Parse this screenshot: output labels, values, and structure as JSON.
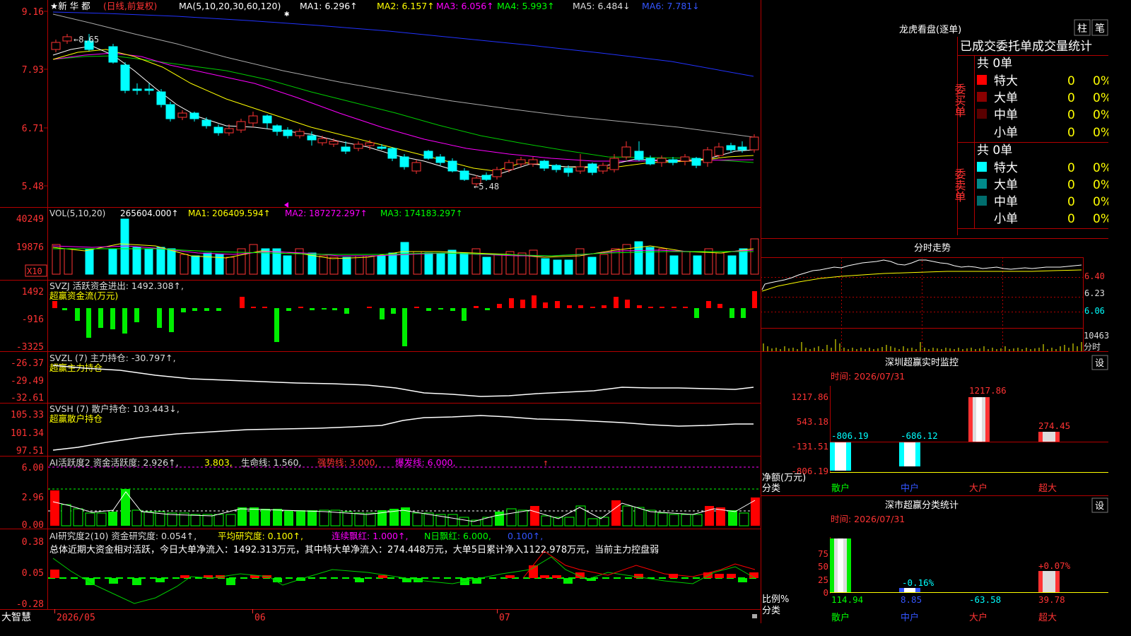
{
  "app": {
    "name": "大智慧"
  },
  "stock": {
    "name": "★新 华 都",
    "mode": "(日线,前复权)"
  },
  "ma_header": {
    "label": "MA(5,10,20,30,60,120)",
    "ma1": "MA1: 6.296↑",
    "ma2": "MA2: 6.157↑",
    "ma3": "MA3: 6.056↑",
    "ma4": "MA4: 5.993↑",
    "ma5": "MA5: 6.484↓",
    "ma6": "MA6: 7.781↓"
  },
  "price_axis": [
    "9.16",
    "7.93",
    "6.71",
    "5.48"
  ],
  "price_annotations": {
    "high": "←8.65",
    "low": "←5.48"
  },
  "vol": {
    "header": "VOL(5,10,20)",
    "value": "265604.000↑",
    "ma1": "MA1: 206409.594↑",
    "ma2": "MA2: 187272.297↑",
    "ma3": "MA3: 174183.297↑",
    "axis": [
      "40249",
      "19876"
    ],
    "unit": "X10"
  },
  "svzj": {
    "header": "SVZJ  活跃资金进出: 1492.308↑,",
    "subtitle": "超赢资金流(万元)",
    "axis": [
      "1492",
      "-916",
      "-3325"
    ]
  },
  "svzl": {
    "header": "SVZL (7) 主力持仓: -30.797↑,",
    "subtitle": "超赢主力持仓",
    "axis": [
      "-26.37",
      "-29.49",
      "-32.61"
    ]
  },
  "svsh": {
    "header": "SVSH (7) 散户持仓: 103.443↓,",
    "subtitle": "超赢散户持仓",
    "axis": [
      "105.33",
      "101.34",
      "97.51"
    ]
  },
  "ai1": {
    "header_a": "AI活跃度2 资金活跃度: 2.926↑,",
    "header_b": "3.803,",
    "header_c": "生命线: 1.560,",
    "header_d": "强势线: 3.000,",
    "header_e": "爆发线: 6.000,",
    "axis": [
      "6.00",
      "2.96",
      "0.00"
    ]
  },
  "ai2": {
    "header_a": "AI研究度2(10) 资金研究度: 0.054↑,",
    "header_b": "平均研究度: 0.100↑,",
    "header_c": "连续飘红: 1.000↑,",
    "header_d": "N日飘红: 6.000,",
    "header_e": "0.100↑,",
    "summary": "总体近期大资金相对活跃，今日大单净流入：1492.313万元，其中特大单净流入：274.448万元，大单5日累计净入1122.978万元，当前主力控盘弱",
    "axis": [
      "0.38",
      "0.05",
      "-0.28"
    ]
  },
  "date_axis": [
    "2026/05",
    "06",
    "07"
  ],
  "right_panel": {
    "lhkp_title": "龙虎看盘(逐单)",
    "btn_zhu": "柱",
    "btn_bi": "笔",
    "tabs": "已成交委托单成交量统计",
    "buy_label": "委买单",
    "sell_label": "委卖单",
    "buy_total": "共 0单",
    "sell_total": "共 0单",
    "buy_rows": [
      {
        "label": "特大",
        "count": "0",
        "pct": "0%",
        "color": "#ff0000"
      },
      {
        "label": "大单",
        "count": "0",
        "pct": "0%",
        "color": "#8b0000"
      },
      {
        "label": "中单",
        "count": "0",
        "pct": "0%",
        "color": "#5a0000"
      },
      {
        "label": "小单",
        "count": "0",
        "pct": "0%",
        "color": "#000000"
      }
    ],
    "sell_rows": [
      {
        "label": "特大",
        "count": "0",
        "pct": "0%",
        "color": "#00ffff"
      },
      {
        "label": "大单",
        "count": "0",
        "pct": "0%",
        "color": "#008b8b"
      },
      {
        "label": "中单",
        "count": "0",
        "pct": "0%",
        "color": "#006d6d"
      },
      {
        "label": "小单",
        "count": "0",
        "pct": "0%",
        "color": "#000000"
      }
    ],
    "fenshi_title": "分时走势",
    "fenshi_axis": [
      "6.40",
      "6.23",
      "6.06"
    ],
    "fenshi_vol": "10463",
    "fenshi_vol_label": "分时",
    "sz_monitor_title": "深圳超赢实时监控",
    "sz_monitor_time": "时间: 2026/07/31",
    "sz_monitor_axis": [
      "1217.86",
      "543.18",
      "-131.51",
      "-806.19"
    ],
    "sz_monitor_ylabel": "净额(万元)",
    "sz_monitor_xlabel": "分类",
    "sz_monitor_bars": [
      {
        "name": "散户",
        "label": "-806.19"
      },
      {
        "name": "中户",
        "label": "-686.12"
      },
      {
        "name": "大户",
        "label": "1217.86"
      },
      {
        "name": "超大",
        "label": "274.45"
      }
    ],
    "set_btn": "设",
    "sz_class_title": "深市超赢分类统计",
    "sz_class_time": "时间: 2026/07/31",
    "sz_class_axis": [
      "75",
      "50",
      "25",
      "0"
    ],
    "sz_class_ylabel": "比例%",
    "sz_class_xlabel": "分类",
    "sz_class_bars": [
      {
        "name": "散户",
        "label": "114.94",
        "pct": ""
      },
      {
        "name": "中户",
        "label": "8.85",
        "pct": "-0.16%"
      },
      {
        "name": "大户",
        "label": "-63.58",
        "pct": ""
      },
      {
        "name": "超大",
        "label": "39.78",
        "pct": "+0.07%"
      }
    ]
  },
  "chart_data": [
    {
      "type": "candlestick",
      "title": "新华都 日线 前复权",
      "ylim": [
        5.2,
        9.3
      ],
      "yticks": [
        9.16,
        7.93,
        6.71,
        5.48
      ],
      "series": [
        {
          "name": "MA1",
          "value": 6.296
        },
        {
          "name": "MA2",
          "value": 6.157
        },
        {
          "name": "MA3",
          "value": 6.056
        },
        {
          "name": "MA4",
          "value": 5.993
        },
        {
          "name": "MA5",
          "value": 6.484
        },
        {
          "name": "MA6",
          "value": 7.781
        }
      ],
      "annotations": [
        "high 8.65",
        "low 5.48"
      ]
    },
    {
      "type": "bar",
      "title": "VOL(5,10,20)",
      "values_latest": [
        265604.0,
        206409.594,
        187272.297,
        174183.297
      ]
    },
    {
      "type": "bar",
      "title": "超赢资金流(万元)",
      "latest": 1492.308
    },
    {
      "type": "line",
      "title": "超赢主力持仓",
      "latest": -30.797
    },
    {
      "type": "line",
      "title": "超赢散户持仓",
      "latest": 103.443
    },
    {
      "type": "bar",
      "title": "深圳超赢实时监控",
      "categories": [
        "散户",
        "中户",
        "大户",
        "超大"
      ],
      "values": [
        -806.19,
        -686.12,
        1217.86,
        274.45
      ]
    },
    {
      "type": "bar",
      "title": "深市超赢分类统计",
      "categories": [
        "散户",
        "中户",
        "大户",
        "超大"
      ],
      "values": [
        114.94,
        8.85,
        -63.58,
        39.78
      ]
    }
  ]
}
